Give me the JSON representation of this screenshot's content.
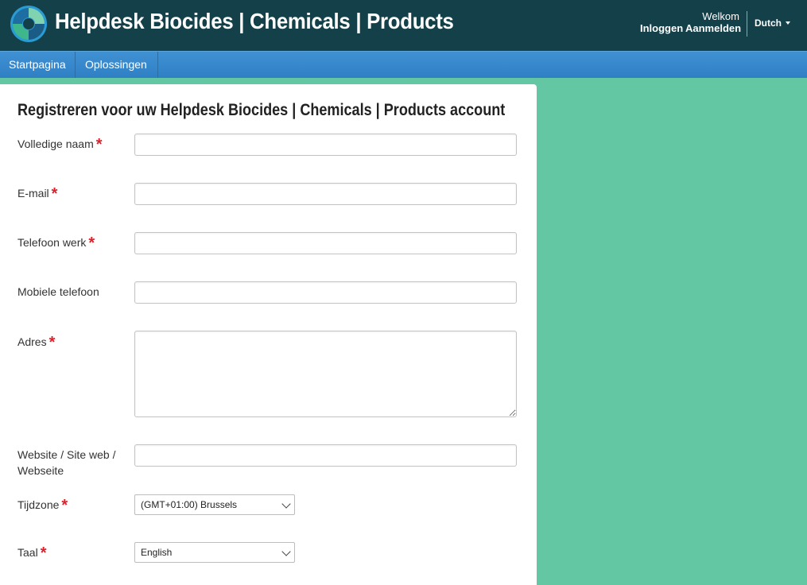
{
  "header": {
    "brand": "Helpdesk Biocides | Chemicals | Products",
    "welcome": "Welkom",
    "login": "Inloggen",
    "signup": "Aanmelden",
    "language": "Dutch",
    "logo_icon": "helpdesk-logo-icon"
  },
  "nav": {
    "items": [
      {
        "label": "Startpagina"
      },
      {
        "label": "Oplossingen"
      }
    ]
  },
  "form": {
    "title": "Registreren voor uw Helpdesk Biocides | Chemicals | Products account",
    "required_mark": "*",
    "fields": {
      "full_name": {
        "label": "Volledige naam",
        "value": ""
      },
      "email": {
        "label": "E-mail",
        "value": ""
      },
      "work_phone": {
        "label": "Telefoon werk",
        "value": ""
      },
      "mobile_phone": {
        "label": "Mobiele telefoon",
        "value": ""
      },
      "address": {
        "label": "Adres",
        "value": ""
      },
      "website": {
        "label_line1": "Website / Site web /",
        "label_line2": "Webseite",
        "value": ""
      },
      "timezone": {
        "label": "Tijdzone",
        "value": "(GMT+01:00) Brussels"
      },
      "language": {
        "label": "Taal",
        "value": "English"
      }
    }
  },
  "colors": {
    "header_bg": "#14404a",
    "nav_bg": "#3a8bd0",
    "page_bg": "#64c7a4",
    "required": "#e0202a"
  }
}
